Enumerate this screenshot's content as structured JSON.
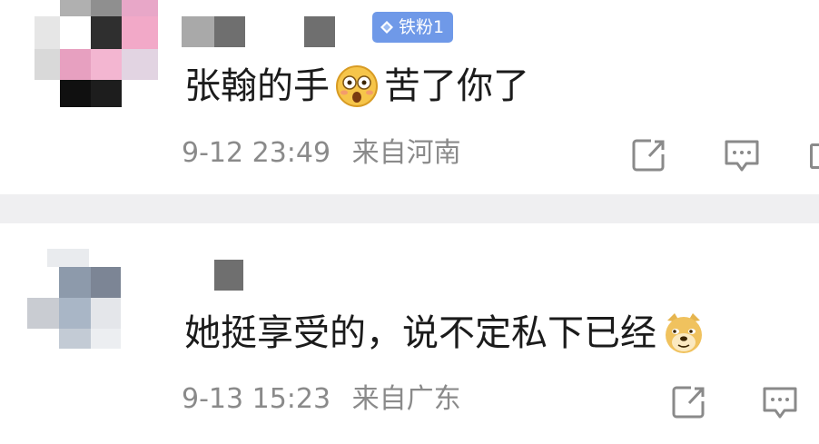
{
  "comments": [
    {
      "badge": "铁粉1",
      "text_before": "张翰的手",
      "emoji": "flushed-face",
      "text_after": "苦了你了",
      "timestamp": "9-12 23:49",
      "location": "来自河南"
    },
    {
      "text_before": "她挺享受的，说不定私下已经",
      "emoji": "doge-face",
      "text_after": "",
      "timestamp": "9-13 15:23",
      "location": "来自广东"
    }
  ],
  "colors": {
    "badge_bg": "#6f99e8",
    "meta_text": "#8a8a8a",
    "divider": "#efeff1"
  }
}
